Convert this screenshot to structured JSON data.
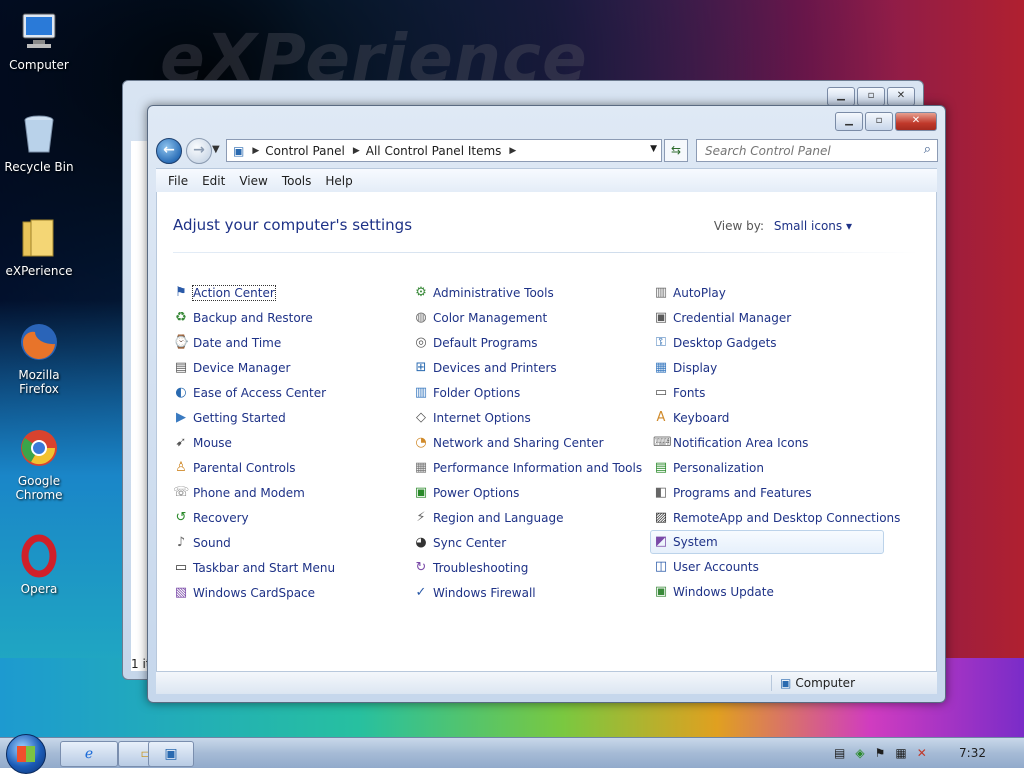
{
  "desktop": {
    "wallpaper_text": "eXPerience",
    "icons": [
      {
        "label": "Computer"
      },
      {
        "label": "Recycle Bin"
      },
      {
        "label": "eXPerience"
      },
      {
        "label": "Mozilla Firefox"
      },
      {
        "label": "Google Chrome"
      },
      {
        "label": "Opera"
      }
    ]
  },
  "back_window": {
    "status": "1 it"
  },
  "window": {
    "address": {
      "crumbs": [
        "Control Panel",
        "All Control Panel Items"
      ]
    },
    "search": {
      "placeholder": "Search Control Panel"
    },
    "menu": [
      "File",
      "Edit",
      "View",
      "Tools",
      "Help"
    ],
    "heading": "Adjust your computer's settings",
    "view_by_label": "View by:",
    "view_by_value": "Small icons",
    "columns": [
      [
        "Action Center",
        "Backup and Restore",
        "Date and Time",
        "Device Manager",
        "Ease of Access Center",
        "Getting Started",
        "Mouse",
        "Parental Controls",
        "Phone and Modem",
        "Recovery",
        "Sound",
        "Taskbar and Start Menu",
        "Windows CardSpace"
      ],
      [
        "Administrative Tools",
        "Color Management",
        "Default Programs",
        "Devices and Printers",
        "Folder Options",
        "Internet Options",
        "Network and Sharing Center",
        "Performance Information and Tools",
        "Power Options",
        "Region and Language",
        "Sync Center",
        "Troubleshooting",
        "Windows Firewall"
      ],
      [
        "AutoPlay",
        "Credential Manager",
        "Desktop Gadgets",
        "Display",
        "Fonts",
        "Keyboard",
        "Notification Area Icons",
        "Personalization",
        "Programs and Features",
        "RemoteApp and Desktop Connections",
        "System",
        "User Accounts",
        "Windows Update"
      ]
    ],
    "highlighted_item": "System",
    "status_location": "Computer"
  },
  "taskbar": {
    "clock": "7:32"
  },
  "colors": {
    "link": "#1e3287",
    "heading": "#1e3287"
  }
}
